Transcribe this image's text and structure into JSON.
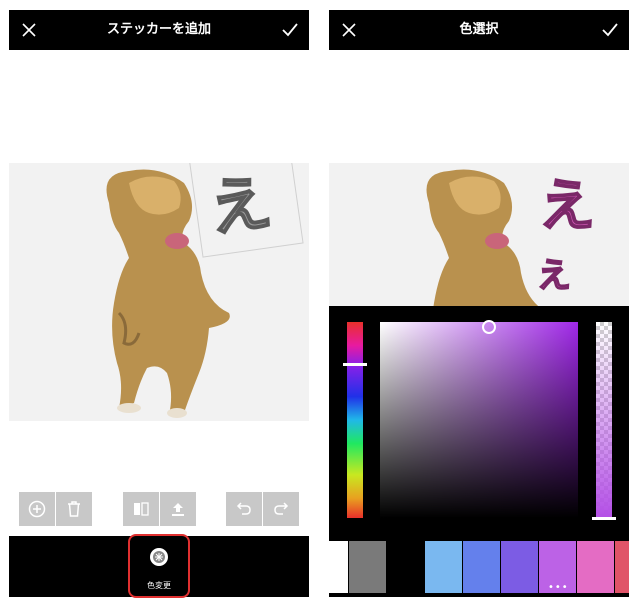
{
  "left_screen": {
    "title": "ステッカーを追加",
    "sticker_text": "え",
    "bottom_button_label": "色変更"
  },
  "right_screen": {
    "title": "色選択",
    "sticker_text_large": "え",
    "sticker_text_small": "え"
  },
  "colors": {
    "header_bg": "#000000",
    "highlight": "#e03030",
    "selected_color": "#a028e8"
  },
  "swatches": [
    {
      "color": "#ffffff"
    },
    {
      "color": "#7a7a7a"
    },
    {
      "color": "#000000"
    },
    {
      "color": "#7ab8f0"
    },
    {
      "color": "#6480ec"
    },
    {
      "color": "#7c5ce4"
    },
    {
      "color": "#bc62e6"
    },
    {
      "color": "#e46cc4"
    },
    {
      "color": "#e05468"
    }
  ]
}
